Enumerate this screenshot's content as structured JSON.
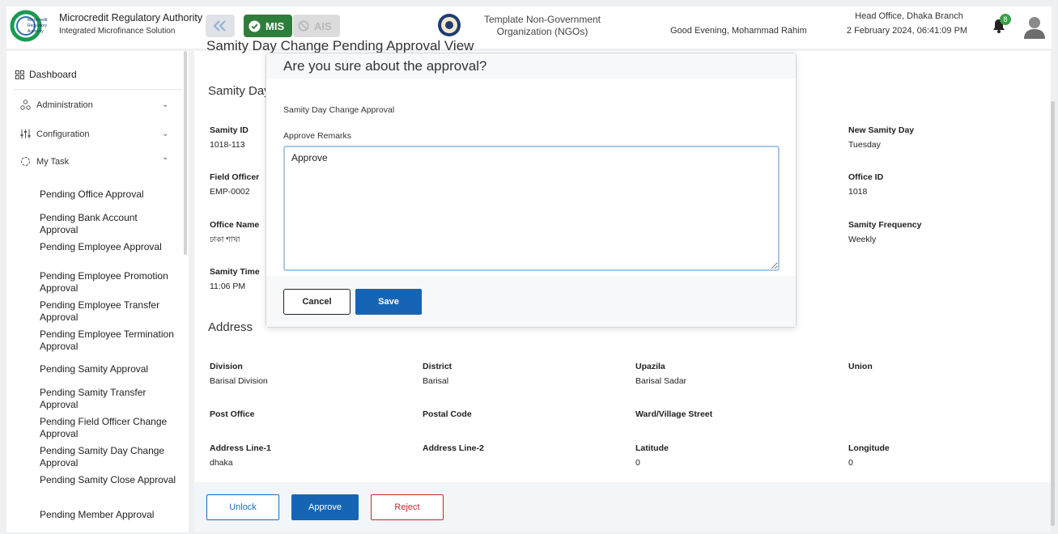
{
  "header": {
    "brand_title": "Microcredit Regulatory Authority",
    "brand_subtitle": "Integrated Microfinance Solution",
    "logo_text": [
      "Microcredit",
      "Regulatory",
      "Authority"
    ],
    "mis_label": "MIS",
    "ais_label": "AIS",
    "org_name_line1": "Template Non-Government",
    "org_name_line2": "Organization (NGOs)",
    "greeting": "Good Evening, Mohammad Rahim",
    "branch": "Head Office, Dhaka Branch",
    "datetime": "2 February 2024, 06:41:09 PM",
    "notification_count": "8"
  },
  "sidebar": {
    "dashboard": "Dashboard",
    "groups": [
      {
        "label": "Administration",
        "icon": "admin-icon",
        "chevron": "down"
      },
      {
        "label": "Configuration",
        "icon": "sliders-icon",
        "chevron": "down"
      },
      {
        "label": "My Task",
        "icon": "task-icon",
        "chevron": "up"
      }
    ],
    "items": [
      "Pending Office Approval",
      "Pending Bank Account Approval",
      "Pending Employee Approval",
      "Pending Employee Promotion Approval",
      "Pending Employee Transfer Approval",
      "Pending Employee Termination Approval",
      "Pending Samity Approval",
      "Pending Samity Transfer Approval",
      "Pending Field Officer Change Approval",
      "Pending Samity Day Change Approval",
      "Pending Samity Close Approval",
      "Pending Member Approval"
    ]
  },
  "main": {
    "page_title": "Samity Day Change Pending Approval View",
    "section1_title": "Samity Day",
    "fields": {
      "samity_id_label": "Samity ID",
      "samity_id": "1018-113",
      "new_day_label": "New Samity Day",
      "new_day": "Tuesday",
      "field_officer_label": "Field Officer",
      "field_officer": "EMP-0002",
      "office_id_label": "Office ID",
      "office_id": "1018",
      "office_name_label": "Office Name",
      "office_name": "ঢাকা শাখা",
      "frequency_label": "Samity Frequency",
      "frequency": "Weekly",
      "time_label": "Samity Time",
      "time": "11:06 PM"
    },
    "address_title": "Address",
    "address": {
      "division_label": "Division",
      "division": "Barisal Division",
      "district_label": "District",
      "district": "Barisal",
      "upazila_label": "Upazila",
      "upazila": "Barisal Sadar",
      "union_label": "Union",
      "post_office_label": "Post Office",
      "postal_code_label": "Postal Code",
      "ward_label": "Ward/Village Street",
      "line1_label": "Address Line-1",
      "line1": "dhaka",
      "line2_label": "Address Line-2",
      "lat_label": "Latitude",
      "lat": "0",
      "lng_label": "Longitude",
      "lng": "0"
    },
    "buttons": {
      "unlock": "Unlock",
      "approve": "Approve",
      "reject": "Reject"
    }
  },
  "modal": {
    "title": "Are you sure about the approval?",
    "subtitle": "Samity Day Change Approval",
    "remarks_label": "Approve Remarks",
    "remarks_value": "Approve",
    "cancel": "Cancel",
    "save": "Save"
  },
  "colors": {
    "primary": "#1565b4",
    "mis_green": "#2f7d3a",
    "reject_red": "#c62828"
  }
}
